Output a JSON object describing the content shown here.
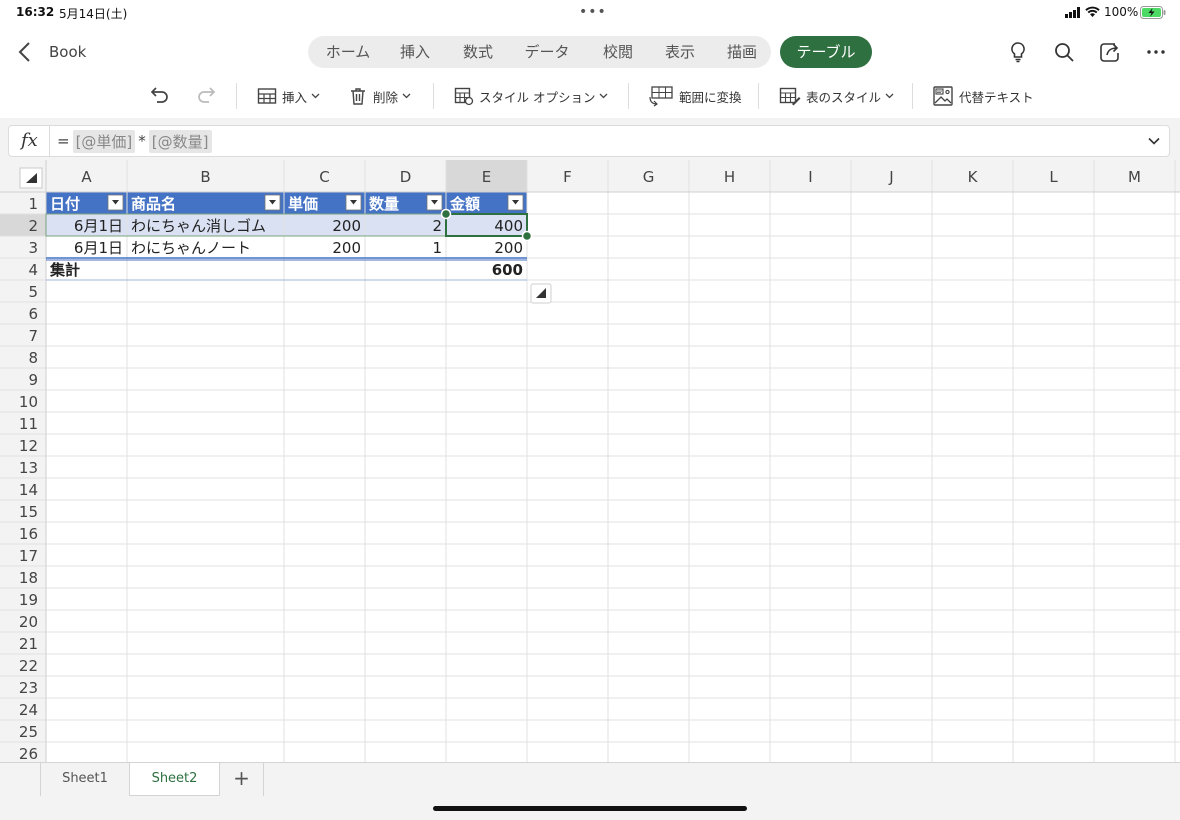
{
  "status": {
    "time": "16:32",
    "date": "5月14日(土)",
    "battery": "100%"
  },
  "header": {
    "back_label": "Book",
    "tabs": [
      "ホーム",
      "挿入",
      "数式",
      "データ",
      "校閲",
      "表示",
      "描画"
    ],
    "active_tab": "テーブル"
  },
  "toolbar": {
    "insert": "挿入",
    "delete": "削除",
    "style_options": "スタイル オプション",
    "convert": "範囲に変換",
    "table_style": "表のスタイル",
    "alt_text": "代替テキスト"
  },
  "formula": {
    "eq": "=",
    "tok1": "[@単価]",
    "op": "*",
    "tok2": "[@数量]"
  },
  "grid": {
    "columns": [
      "A",
      "B",
      "C",
      "D",
      "E",
      "F",
      "G",
      "H",
      "I",
      "J",
      "K",
      "L",
      "M"
    ],
    "row_count": 26,
    "selected_column": "E",
    "selected_row": 2
  },
  "table": {
    "headers": [
      "日付",
      "商品名",
      "単価",
      "数量",
      "金額"
    ],
    "rows": [
      [
        "6月1日",
        "わにちゃん消しゴム",
        "200",
        "2",
        "400"
      ],
      [
        "6月1日",
        "わにちゃんノート",
        "200",
        "1",
        "200"
      ]
    ],
    "total_label": "集計",
    "total_value": "600",
    "header_color": "#4472c4",
    "band_color": "#d9e1f2"
  },
  "sheets": {
    "tabs": [
      "Sheet1",
      "Sheet2"
    ],
    "active": "Sheet2"
  },
  "colors": {
    "accent": "#2e7040",
    "header_bg": "#4472c4"
  }
}
